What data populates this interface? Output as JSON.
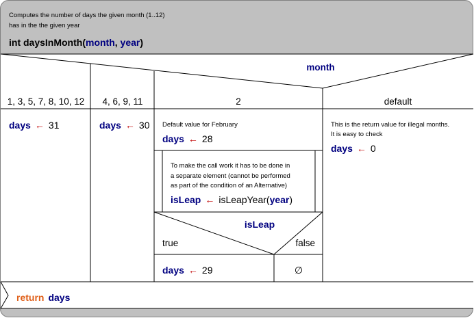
{
  "header": {
    "comment_line1": "Computes the number of days the given month (1..12)",
    "comment_line2": "has in the the given year",
    "signature_prefix": "int daysInMonth(",
    "param1": "month",
    "separator": ", ",
    "param2": "year",
    "signature_suffix": ")"
  },
  "switch": {
    "selector": "month",
    "cases": [
      "1, 3, 5, 7, 8, 10, 12",
      "4, 6, 9, 11",
      "2",
      "default"
    ]
  },
  "case1": {
    "var": "days",
    "arrow": "←",
    "value": "31"
  },
  "case2": {
    "var": "days",
    "arrow": "←",
    "value": "30"
  },
  "case3": {
    "comment": "Default value for February",
    "var": "days",
    "arrow": "←",
    "value": "28",
    "sub_comment_line1": "To make the call work it has to be done in",
    "sub_comment_line2": "a separate element (cannot be performed",
    "sub_comment_line3": "as part of the condition of an Alternative)",
    "call_var": "isLeap",
    "call_arrow": "←",
    "call_fn": "isLeapYear(",
    "call_arg": "year",
    "call_close": ")",
    "condition": "isLeap",
    "true_label": "true",
    "false_label": "false",
    "true_var": "days",
    "true_arrow": "←",
    "true_value": "29",
    "false_symbol": "∅"
  },
  "case4": {
    "comment_line1": "This is the return value for illegal months.",
    "comment_line2": "It is easy to check",
    "var": "days",
    "arrow": "←",
    "value": "0"
  },
  "footer": {
    "keyword": "return",
    "var": "days"
  },
  "colors": {
    "header_bg": "#c0c0c0",
    "keyword": "#000080",
    "return_keyword": "#e0601a",
    "assign_arrow": "#c00000",
    "outer_frame": "#808080"
  }
}
